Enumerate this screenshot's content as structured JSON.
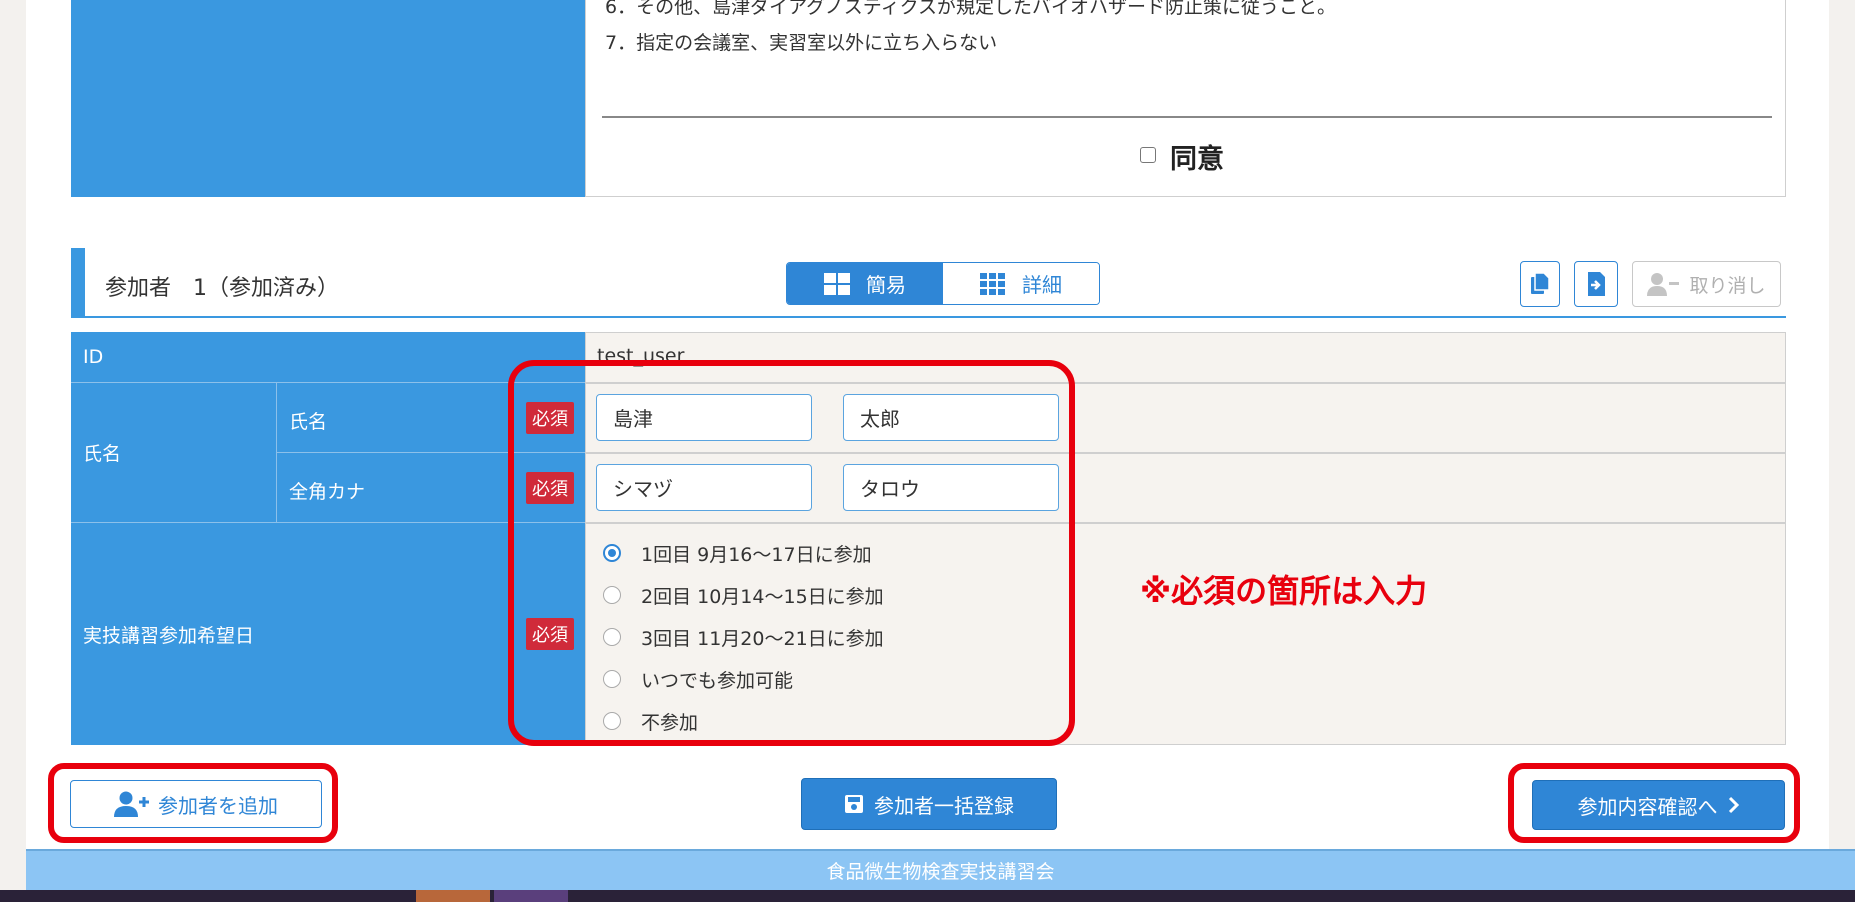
{
  "terms": {
    "item6": "6．その他、島津ダイアグノスティクスが規定したバイオハザード防止策に従うこと。",
    "item7": "7．指定の会議室、実習室以外に立ち入らない",
    "agree_label": "同意"
  },
  "participant": {
    "heading": "参加者　1（参加済み）",
    "view_simple": "簡易",
    "view_detail": "詳細",
    "cancel_label": "取り消し"
  },
  "form": {
    "id_label": "ID",
    "id_value": "test_user",
    "name_group_label": "氏名",
    "name_label": "氏名",
    "kana_label": "全角カナ",
    "required_badge": "必須",
    "last_name": "島津",
    "first_name": "太郎",
    "last_kana": "シマヅ",
    "first_kana": "タロウ",
    "date_label": "実技講習参加希望日",
    "date_options": [
      {
        "label": "1回目 9月16～17日に参加",
        "checked": true
      },
      {
        "label": "2回目 10月14～15日に参加",
        "checked": false
      },
      {
        "label": "3回目 11月20～21日に参加",
        "checked": false
      },
      {
        "label": "いつでも参加可能",
        "checked": false
      },
      {
        "label": "不参加",
        "checked": false
      }
    ]
  },
  "annotation": "※必須の箇所は入力",
  "actions": {
    "add_participant": "参加者を追加",
    "bulk_register": "参加者一括登録",
    "confirm": "参加内容確認へ"
  },
  "footer": {
    "text": "食品微生物検査実技講習会"
  },
  "colors": {
    "brand_blue": "#3a98e0",
    "required_red": "#d02a3a",
    "highlight_red": "#e8000d"
  }
}
